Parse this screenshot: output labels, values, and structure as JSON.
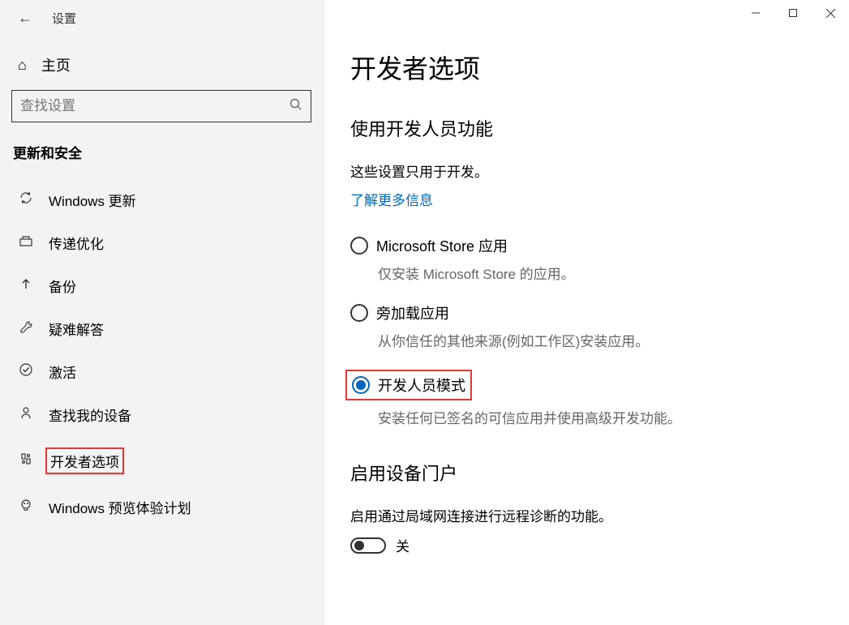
{
  "app": {
    "title": "设置"
  },
  "sidebar": {
    "home": "主页",
    "search_placeholder": "查找设置",
    "category": "更新和安全",
    "items": [
      {
        "label": "Windows 更新"
      },
      {
        "label": "传递优化"
      },
      {
        "label": "备份"
      },
      {
        "label": "疑难解答"
      },
      {
        "label": "激活"
      },
      {
        "label": "查找我的设备"
      },
      {
        "label": "开发者选项",
        "highlighted": true
      },
      {
        "label": "Windows 预览体验计划"
      }
    ]
  },
  "main": {
    "title": "开发者选项",
    "dev_section": {
      "heading": "使用开发人员功能",
      "info": "这些设置只用于开发。",
      "link": "了解更多信息",
      "options": [
        {
          "label": "Microsoft Store 应用",
          "desc": "仅安装 Microsoft Store 的应用。",
          "selected": false
        },
        {
          "label": "旁加载应用",
          "desc": "从你信任的其他来源(例如工作区)安装应用。",
          "selected": false
        },
        {
          "label": "开发人员模式",
          "desc": "安装任何已签名的可信应用并使用高级开发功能。",
          "selected": true,
          "highlighted": true
        }
      ]
    },
    "device_portal": {
      "heading": "启用设备门户",
      "desc": "启用通过局域网连接进行远程诊断的功能。",
      "toggle_state": "关"
    }
  }
}
